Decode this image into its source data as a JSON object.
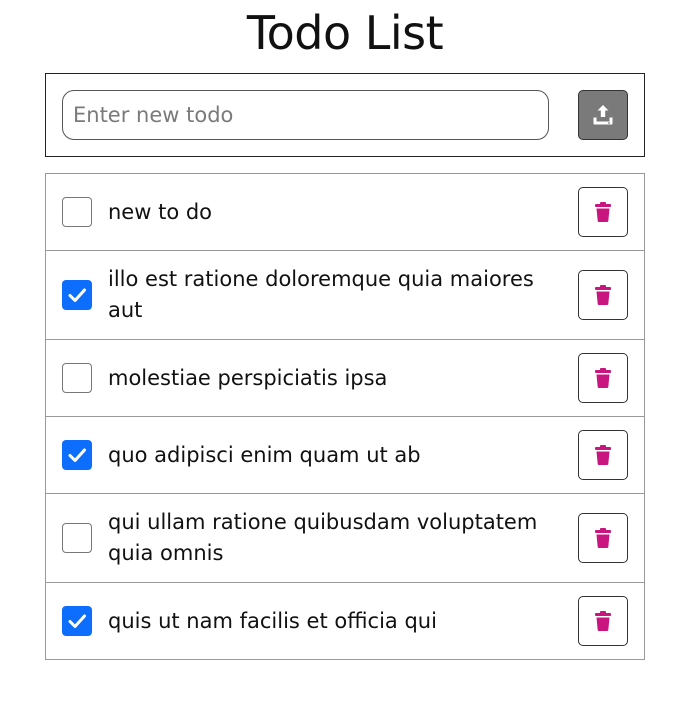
{
  "app": {
    "title": "Todo List"
  },
  "add_form": {
    "input_value": "",
    "input_placeholder": "Enter new todo",
    "submit_icon": "upload-icon",
    "submit_button_color": "#7a7a7a"
  },
  "todos": [
    {
      "text": "new to do",
      "completed": false
    },
    {
      "text": "illo est ratione doloremque quia maiores aut",
      "completed": true
    },
    {
      "text": "molestiae perspiciatis ipsa",
      "completed": false
    },
    {
      "text": "quo adipisci enim quam ut ab",
      "completed": true
    },
    {
      "text": "qui ullam ratione quibusdam voluptatem quia omnis",
      "completed": false
    },
    {
      "text": "quis ut nam facilis et officia qui",
      "completed": true
    }
  ],
  "icons": {
    "delete": "trash-icon",
    "check": "check-icon"
  },
  "colors": {
    "checked": "#0d6efd",
    "delete_icon": "#c8157f",
    "upload_button": "#7a7a7a"
  }
}
